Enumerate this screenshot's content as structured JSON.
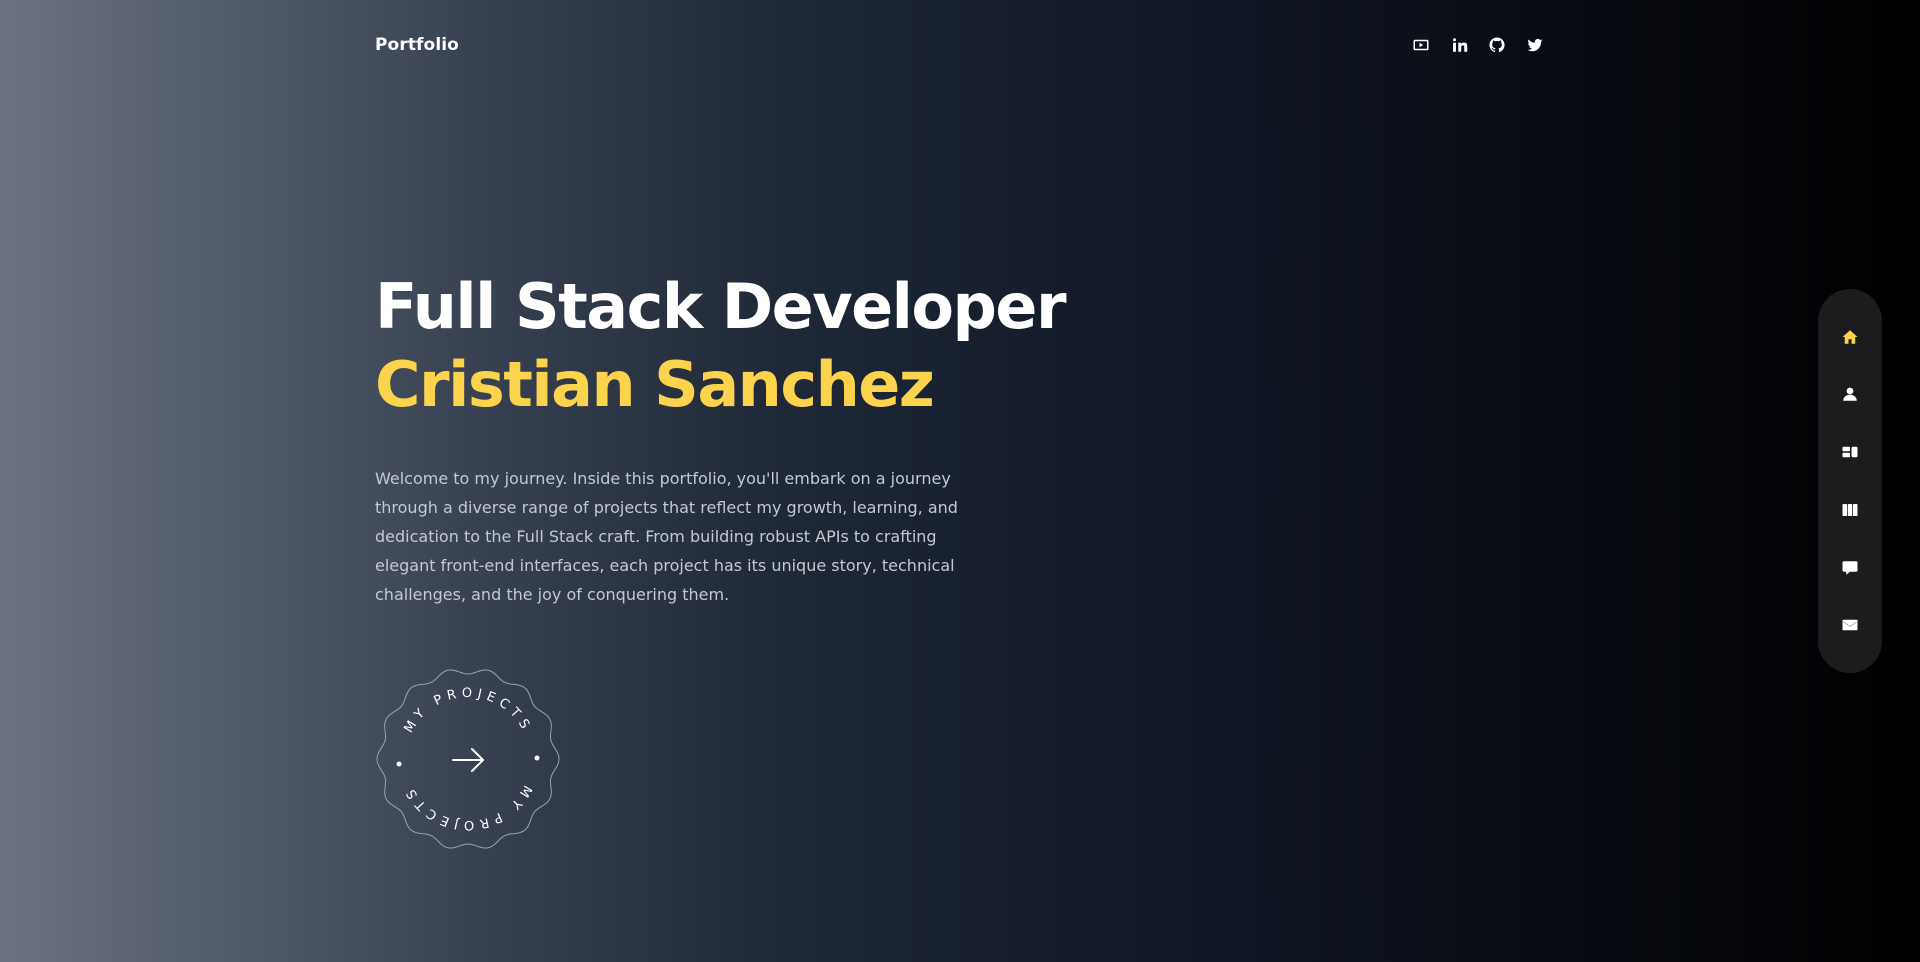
{
  "header": {
    "brand": "Portfolio",
    "social": [
      {
        "name": "youtube-icon"
      },
      {
        "name": "linkedin-icon"
      },
      {
        "name": "github-icon"
      },
      {
        "name": "twitter-icon"
      }
    ]
  },
  "hero": {
    "role": "Full Stack Developer",
    "name": "Cristian Sanchez",
    "intro": "Welcome to my journey. Inside this portfolio, you'll embark on a journey through a diverse range of projects that reflect my growth, learning, and dedication to the Full Stack craft. From building robust APIs to crafting elegant front-end interfaces, each project has its unique story, technical challenges, and the joy of conquering them."
  },
  "badge": {
    "text_top": "MY PROJECTS",
    "text_bottom": "MY PROJECTS",
    "icon": "arrow-right-icon"
  },
  "sidenav": {
    "items": [
      {
        "name": "home-icon",
        "active": true
      },
      {
        "name": "user-icon",
        "active": false
      },
      {
        "name": "services-icon",
        "active": false
      },
      {
        "name": "projects-icon",
        "active": false
      },
      {
        "name": "testimonials-icon",
        "active": false
      },
      {
        "name": "contact-icon",
        "active": false
      }
    ]
  },
  "colors": {
    "accent": "#fcd34d",
    "text": "#ffffff",
    "muted": "#c4c9d1",
    "nav_bg": "#1c1c1e"
  }
}
